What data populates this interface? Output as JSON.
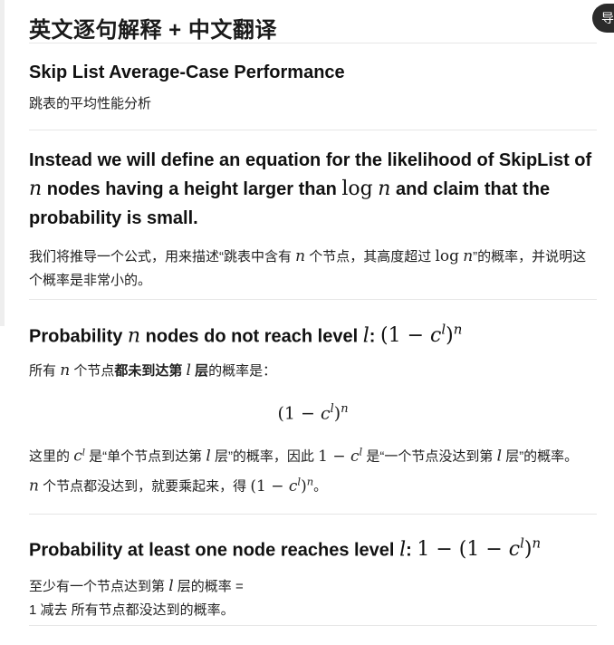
{
  "title": "英文逐句解释 + 中文翻译",
  "badge": "导",
  "s1": {
    "en": "Skip List Average-Case Performance",
    "zh": "跳表的平均性能分析"
  },
  "s2": {
    "en_a": "Instead we will define an equation for the likelihood of SkipList of",
    "en_b": "nodes having a height larger than",
    "en_c": "and claim that the probability is small.",
    "zh_a": "我们将推导一个公式，用来描述“跳表中含有",
    "zh_b": "个节点，其高度超过",
    "zh_c": "”的概率，并说明这个概率是非常小的。"
  },
  "s3": {
    "en_a": "Probability",
    "en_b": "nodes do not reach level",
    "zh1_a": "所有",
    "zh1_b": "个节点",
    "zh1_bold": "都未到达第",
    "zh1_bold2": "层",
    "zh1_c": "的概率是：",
    "zh2_a": "这里的",
    "zh2_b": "是“单个节点到达第",
    "zh2_c": "层”的概率，因此",
    "zh2_d": "是“一个节点没达到第",
    "zh2_e": "层”的概率。",
    "zh3_b": "个节点都没达到，就要乘起来，得",
    "zh3_c": "。"
  },
  "s4": {
    "en_a": "Probability at least one node reaches level",
    "zh1_a": "至少有一个节点达到第",
    "zh1_b": "层的概率 =",
    "zh2": "1 减去 所有节点都没达到的概率。"
  },
  "math": {
    "n": "n",
    "l": "l",
    "log": "log",
    "one": "1",
    "minus": "−",
    "c": "c"
  }
}
